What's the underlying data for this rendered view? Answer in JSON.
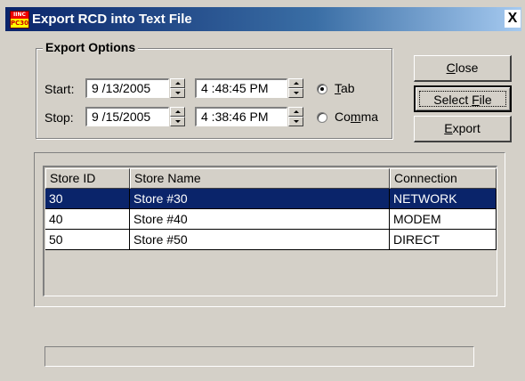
{
  "window": {
    "title": "Export RCD into Text File",
    "close_glyph": "X",
    "icon_top": "IINC",
    "icon_bottom": "PC30"
  },
  "export_options": {
    "legend": "Export Options",
    "start_label": "Start:",
    "stop_label": "Stop:",
    "start_date": "9 /13/2005",
    "start_time": "4 :48:45 PM",
    "stop_date": "9 /15/2005",
    "stop_time": "4 :38:46 PM",
    "delimiters": [
      {
        "label_prefix": "",
        "accel": "T",
        "label_rest": "ab",
        "selected": true
      },
      {
        "label_prefix": "Co",
        "accel": "m",
        "label_rest": "ma",
        "selected": false
      }
    ]
  },
  "buttons": {
    "close": {
      "accel": "C",
      "rest": "lose"
    },
    "select_file": {
      "prefix": "Select ",
      "accel": "F",
      "rest": "ile"
    },
    "export": {
      "accel": "E",
      "rest": "xport"
    }
  },
  "list": {
    "columns": [
      "Store ID",
      "Store Name",
      "Connection"
    ],
    "rows": [
      {
        "id": "30",
        "name": "Store #30",
        "connection": "NETWORK",
        "selected": true
      },
      {
        "id": "40",
        "name": "Store #40",
        "connection": "MODEM",
        "selected": false
      },
      {
        "id": "50",
        "name": "Store #50",
        "connection": "DIRECT",
        "selected": false
      }
    ]
  },
  "colors": {
    "face": "#d4d0c8",
    "selection": "#0a246a",
    "title_start": "#0a246a",
    "title_end": "#a6caf0"
  }
}
